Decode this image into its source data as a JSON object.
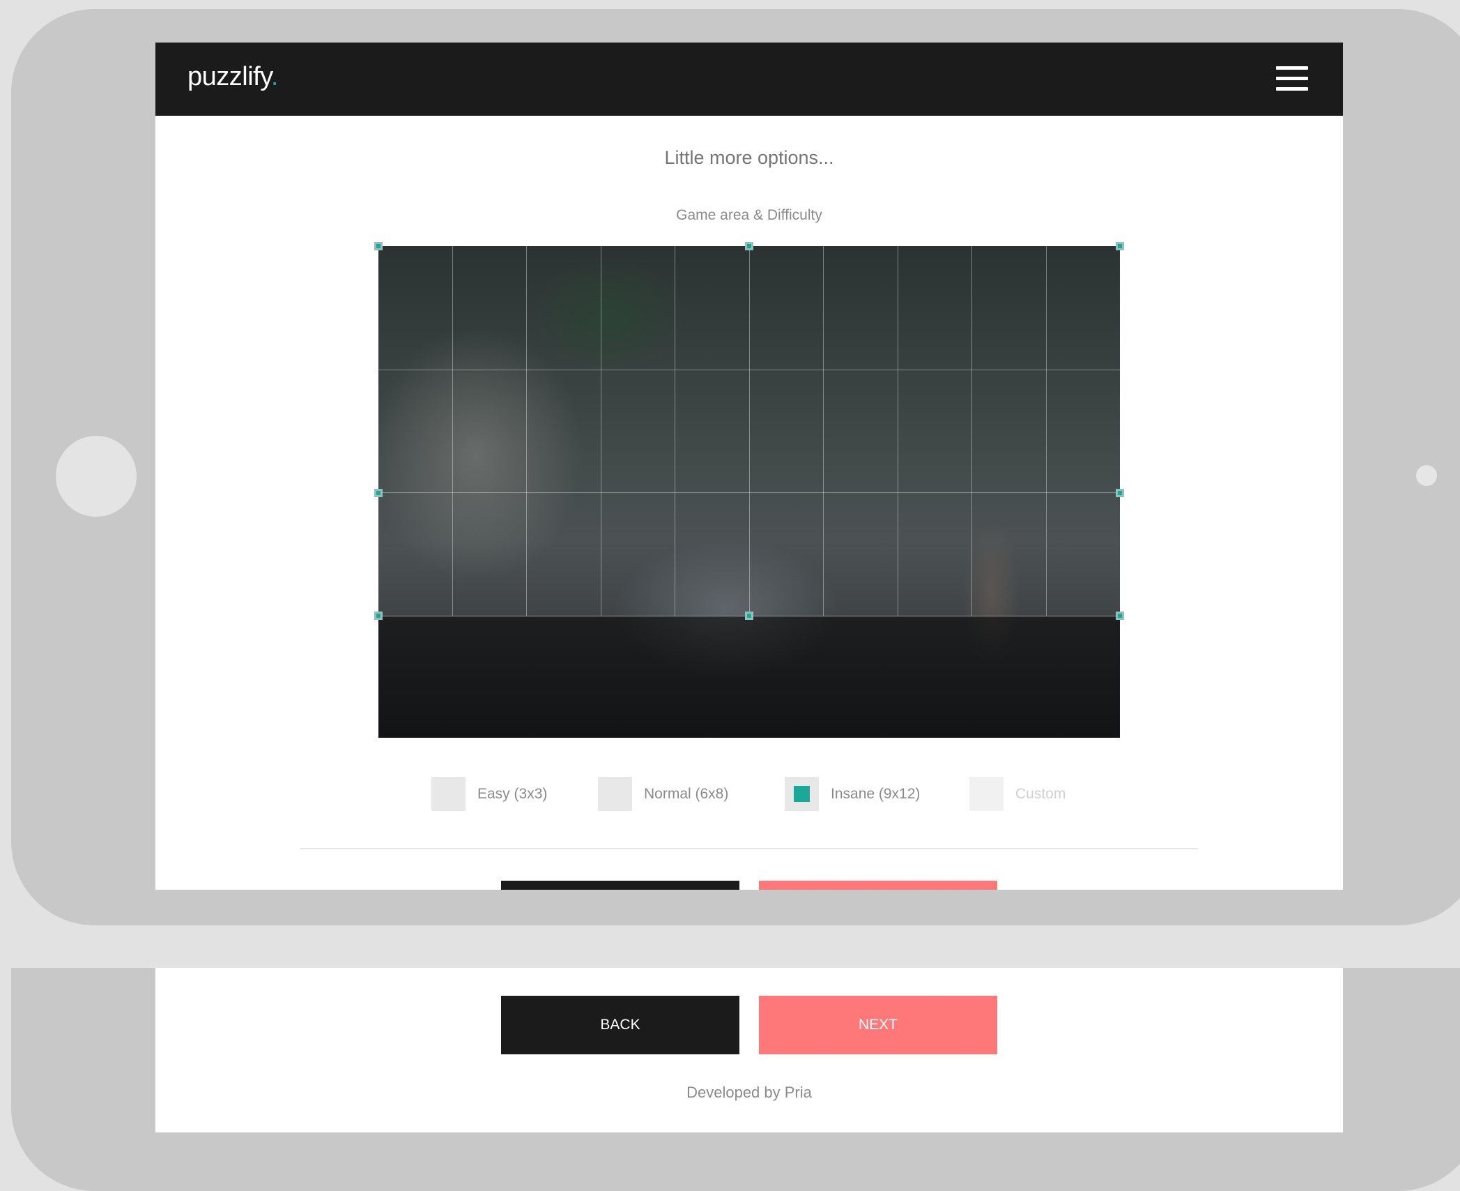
{
  "app": {
    "logo_text": "puzzlify",
    "logo_dot": ".",
    "menu_icon": "hamburger-menu-icon"
  },
  "page": {
    "heading": "Little more options...",
    "section_label": "Game area & Difficulty"
  },
  "difficulty_options": [
    {
      "label": "Easy (3x3)",
      "checked": false,
      "enabled": true
    },
    {
      "label": "Normal (6x8)",
      "checked": false,
      "enabled": true
    },
    {
      "label": "Insane (9x12)",
      "checked": true,
      "enabled": true
    },
    {
      "label": "Custom",
      "checked": false,
      "enabled": false
    }
  ],
  "buttons": {
    "back_label": "BACK",
    "next_label": "NEXT"
  },
  "footer": {
    "credit": "Developed by Pria"
  },
  "colors": {
    "navbar": "#1b1b1b",
    "accent": "#1aa898",
    "next_button": "#fe7779",
    "back_button": "#1b1b1b",
    "device_frame": "#c8c8c8"
  }
}
